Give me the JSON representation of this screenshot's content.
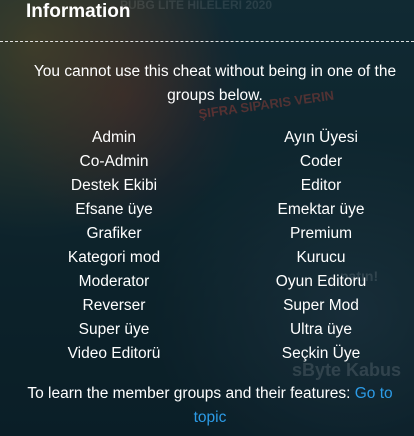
{
  "background": {
    "top_text": "PUBG LITE HILELERI 2020",
    "banner_text": "ŞIFRA SIPARIS VERIN",
    "side_text": "patın!",
    "brand_text": "sByte Kabus"
  },
  "panel": {
    "title": "Information",
    "intro": "You cannot use this cheat without being in one of the groups below.",
    "groups_left": [
      "Admin",
      "Co-Admin",
      "Destek Ekibi",
      "Efsane üye",
      "Grafiker",
      "Kategori mod",
      "Moderator",
      "Reverser",
      "Super üye",
      "Video Editorü"
    ],
    "groups_right": [
      "Ayın Üyesi",
      "Coder",
      "Editor",
      "Emektar üye",
      "Premium",
      "Kurucu",
      "Oyun Editoru",
      "Super Mod",
      "Ultra üye",
      "Seçkin Üye"
    ],
    "footer_text": "To learn the member groups and their features:",
    "footer_link": "Go to topic"
  },
  "colors": {
    "text": "#ffffff",
    "link": "#2c9be6",
    "divider": "#ffffff"
  }
}
